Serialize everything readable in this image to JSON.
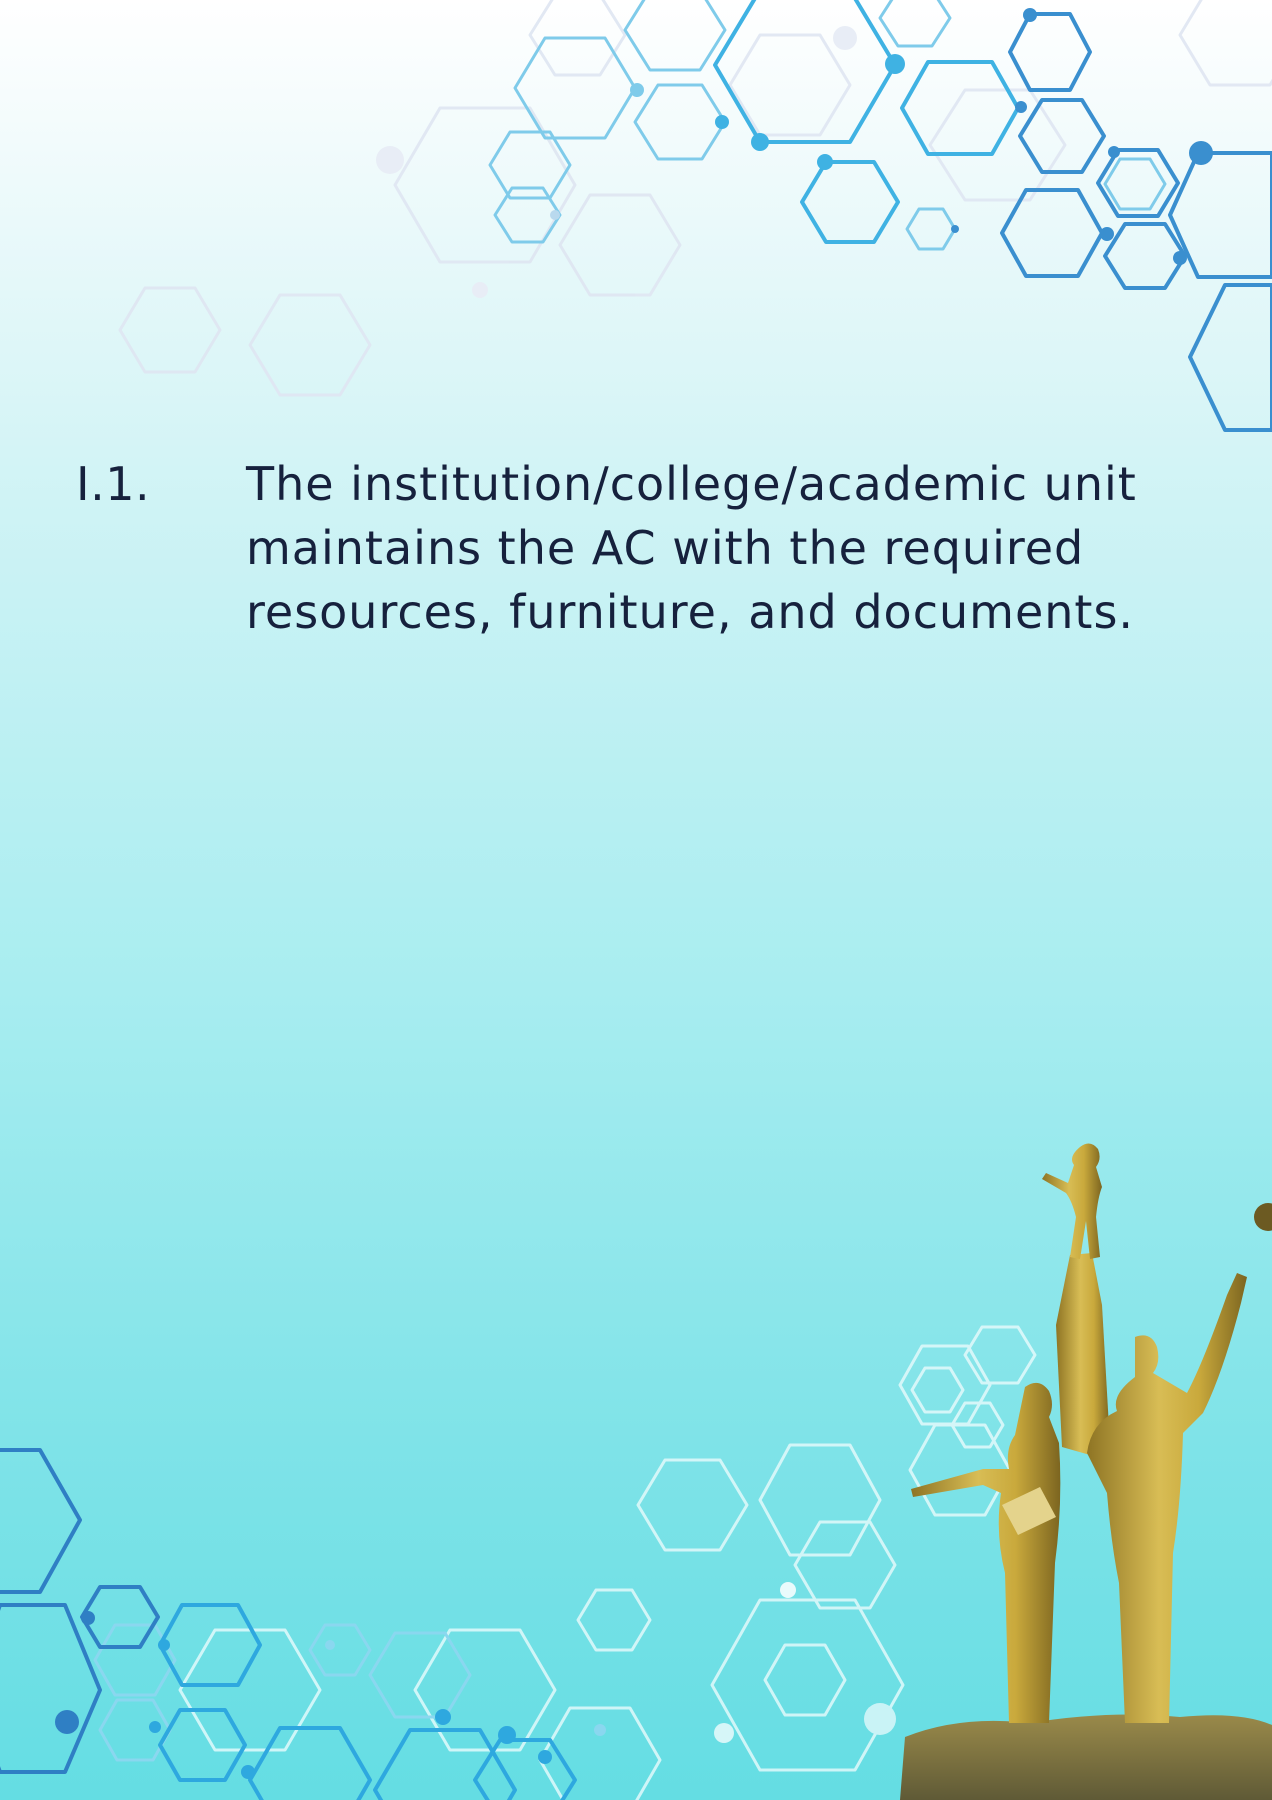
{
  "statement": {
    "number": "I.1.",
    "text": "The institution/college/academic unit\nmaintains the AC with the required\nresources, furniture, and documents."
  },
  "decor": {
    "top_hex_pattern": "hexagon-molecule-pattern",
    "bottom_hex_pattern": "hexagon-molecule-pattern",
    "monument": "golden-statue-monument"
  },
  "colors": {
    "text": "#16213d",
    "hex_dark": "#2f7fc4",
    "hex_mid": "#3fb2e3",
    "hex_light": "#b9d9ee",
    "gold": "#c9a93c"
  }
}
